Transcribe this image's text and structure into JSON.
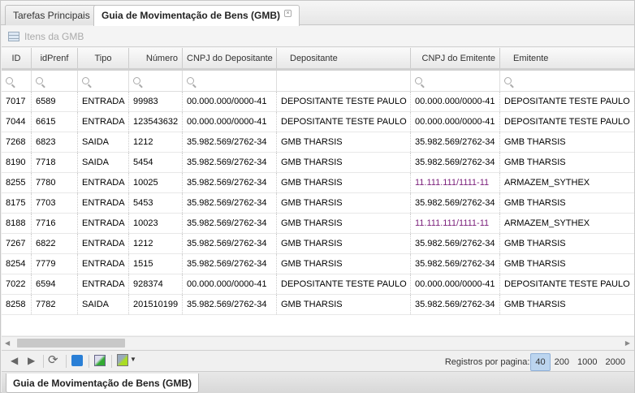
{
  "tabs": [
    {
      "label": "Tarefas Principais"
    },
    {
      "label": "Guia de Movimentação de Bens (GMB)",
      "close": "×"
    }
  ],
  "grid_title": "Itens da GMB",
  "columns": [
    "ID",
    "idPrenf",
    "Tipo",
    "Número",
    "CNPJ do Depositante",
    "Depositante",
    "CNPJ do Emitente",
    "Emitente"
  ],
  "rows": [
    [
      "7017",
      "6589",
      "ENTRADA",
      "99983",
      "00.000.000/0000-41",
      "DEPOSITANTE TESTE PAULO",
      "00.000.000/0000-41",
      "DEPOSITANTE TESTE PAULO"
    ],
    [
      "7044",
      "6615",
      "ENTRADA",
      "123543632",
      "00.000.000/0000-41",
      "DEPOSITANTE TESTE PAULO",
      "00.000.000/0000-41",
      "DEPOSITANTE TESTE PAULO"
    ],
    [
      "7268",
      "6823",
      "SAIDA",
      "1212",
      "35.982.569/2762-34",
      "GMB THARSIS",
      "35.982.569/2762-34",
      "GMB THARSIS"
    ],
    [
      "8190",
      "7718",
      "SAIDA",
      "5454",
      "35.982.569/2762-34",
      "GMB THARSIS",
      "35.982.569/2762-34",
      "GMB THARSIS"
    ],
    [
      "8255",
      "7780",
      "ENTRADA",
      "10025",
      "35.982.569/2762-34",
      "GMB THARSIS",
      "11.111.111/1111-11",
      "ARMAZEM_SYTHEX"
    ],
    [
      "8175",
      "7703",
      "ENTRADA",
      "5453",
      "35.982.569/2762-34",
      "GMB THARSIS",
      "35.982.569/2762-34",
      "GMB THARSIS"
    ],
    [
      "8188",
      "7716",
      "ENTRADA",
      "10023",
      "35.982.569/2762-34",
      "GMB THARSIS",
      "11.111.111/1111-11",
      "ARMAZEM_SYTHEX"
    ],
    [
      "7267",
      "6822",
      "ENTRADA",
      "1212",
      "35.982.569/2762-34",
      "GMB THARSIS",
      "35.982.569/2762-34",
      "GMB THARSIS"
    ],
    [
      "8254",
      "7779",
      "ENTRADA",
      "1515",
      "35.982.569/2762-34",
      "GMB THARSIS",
      "35.982.569/2762-34",
      "GMB THARSIS"
    ],
    [
      "7022",
      "6594",
      "ENTRADA",
      "928374",
      "00.000.000/0000-41",
      "DEPOSITANTE TESTE PAULO",
      "00.000.000/0000-41",
      "DEPOSITANTE TESTE PAULO"
    ],
    [
      "8258",
      "7782",
      "SAIDA",
      "201510199",
      "35.982.569/2762-34",
      "GMB THARSIS",
      "35.982.569/2762-34",
      "GMB THARSIS"
    ]
  ],
  "pager": {
    "label": "Registros por pagina:",
    "sizes": [
      "40",
      "200",
      "1000",
      "2000"
    ],
    "selected": "40"
  },
  "bottom_tab": "Guia de Movimentação de Bens (GMB)",
  "colors": {
    "highlight_cnpj": "#7a1f7a",
    "selected_size": "#bcd5ef"
  }
}
